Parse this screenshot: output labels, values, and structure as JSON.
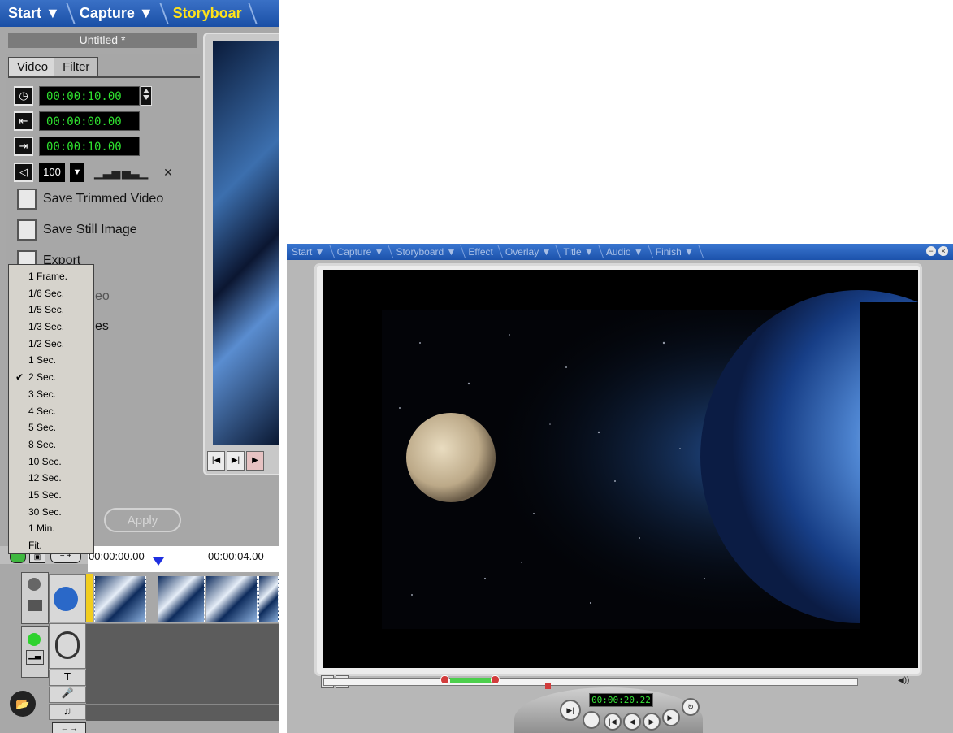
{
  "left_window": {
    "nav": [
      "Start ▼",
      "Capture ▼",
      "Storyboar"
    ],
    "project_title": "Untitled *",
    "tabs": [
      "Video",
      "Filter"
    ],
    "duration_tc": "00:00:10.00",
    "mark_in_tc": "00:00:00.00",
    "mark_out_tc": "00:00:10.00",
    "volume": "100",
    "actions": {
      "save_trimmed": "Save Trimmed Video",
      "save_still": "Save Still Image",
      "export": "Export",
      "partial_1": "eo",
      "partial_2": "es"
    },
    "apply_label": "Apply",
    "zoom_menu": {
      "items": [
        "1 Frame.",
        "1/6 Sec.",
        "1/5 Sec.",
        "1/3 Sec.",
        "1/2 Sec.",
        "1 Sec.",
        "2 Sec.",
        "3 Sec.",
        "4 Sec.",
        "5 Sec.",
        "8 Sec.",
        "10 Sec.",
        "12 Sec.",
        "15 Sec.",
        "30 Sec.",
        "1 Min.",
        "Fit."
      ],
      "checked_index": 6,
      "check_mark": "✔"
    },
    "timeline": {
      "time_start": "00:00:00.00",
      "time_mid": "00:00:04.00"
    }
  },
  "right_window": {
    "nav": [
      "Start ▼",
      "Capture ▼",
      "Storyboard ▼",
      "Effect",
      "Overlay ▼",
      "Title ▼",
      "Audio ▼",
      "Finish ▼"
    ],
    "timecode": "00:00:20.22"
  },
  "colors": {
    "nav_blue": "#1f56b0",
    "active_nav": "#ffe21a",
    "timecode_green": "#2fe02f",
    "playhead_blue": "#1e2fe0",
    "range_green": "#4ccf4c"
  }
}
